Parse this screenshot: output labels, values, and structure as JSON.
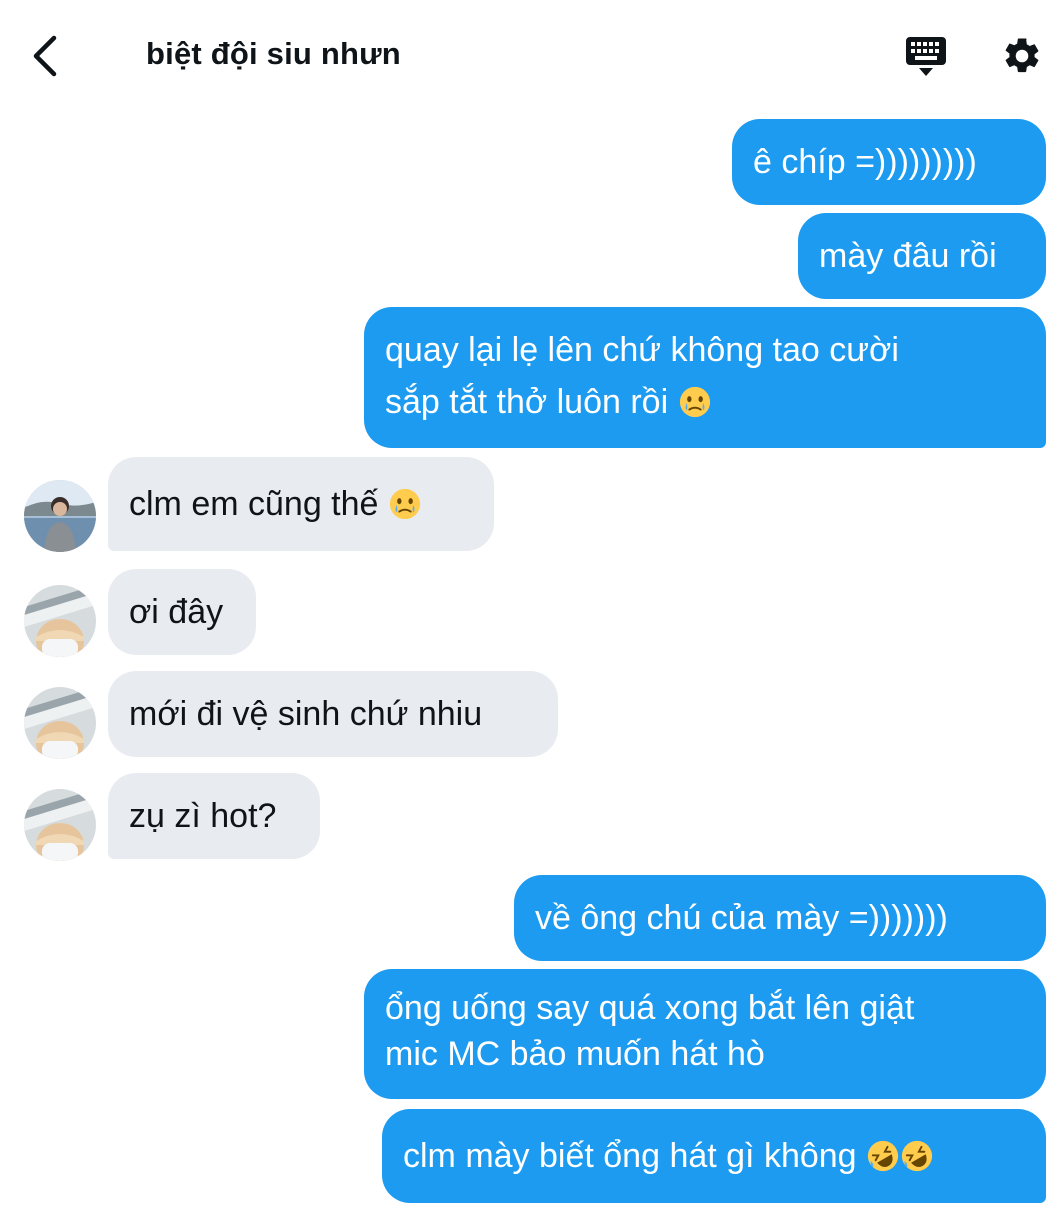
{
  "header": {
    "title": "biệt đội siu nhưn",
    "back_icon": "chevron-left-icon",
    "keyboard_icon": "keyboard-icon",
    "settings_icon": "gear-icon"
  },
  "messages": [
    {
      "direction": "outgoing",
      "text": "ê chíp =)))))))))"
    },
    {
      "direction": "outgoing",
      "text": "mày đâu rồi"
    },
    {
      "direction": "outgoing",
      "line1": "quay lại lẹ lên chứ không tao cười",
      "line2": "sắp tắt thở luôn rồi",
      "emoji": "face-holding-back-tears"
    },
    {
      "direction": "incoming",
      "text": "clm em cũng thế",
      "emoji": "face-holding-back-tears",
      "avatar": "avatar-boy-outdoors"
    },
    {
      "direction": "incoming",
      "text": "ơi đây",
      "avatar": "avatar-masked"
    },
    {
      "direction": "incoming",
      "text": "mới đi vệ sinh chứ nhiu",
      "avatar": "avatar-masked"
    },
    {
      "direction": "incoming",
      "text": "zụ zì hot?",
      "avatar": "avatar-masked"
    },
    {
      "direction": "outgoing",
      "text": "về ông chú của mày =)))))))"
    },
    {
      "direction": "outgoing",
      "line1": "ổng uống say quá xong bắt lên giật",
      "line2": "mic MC bảo muốn hát hò"
    },
    {
      "direction": "outgoing",
      "text": "clm mày biết ổng hát gì không",
      "emoji": "rolling-on-floor-laughing x2"
    }
  ],
  "colors": {
    "outgoing_bubble": "#1d9bf0",
    "incoming_bubble": "#e8ecf0",
    "text": "#0f1419"
  }
}
